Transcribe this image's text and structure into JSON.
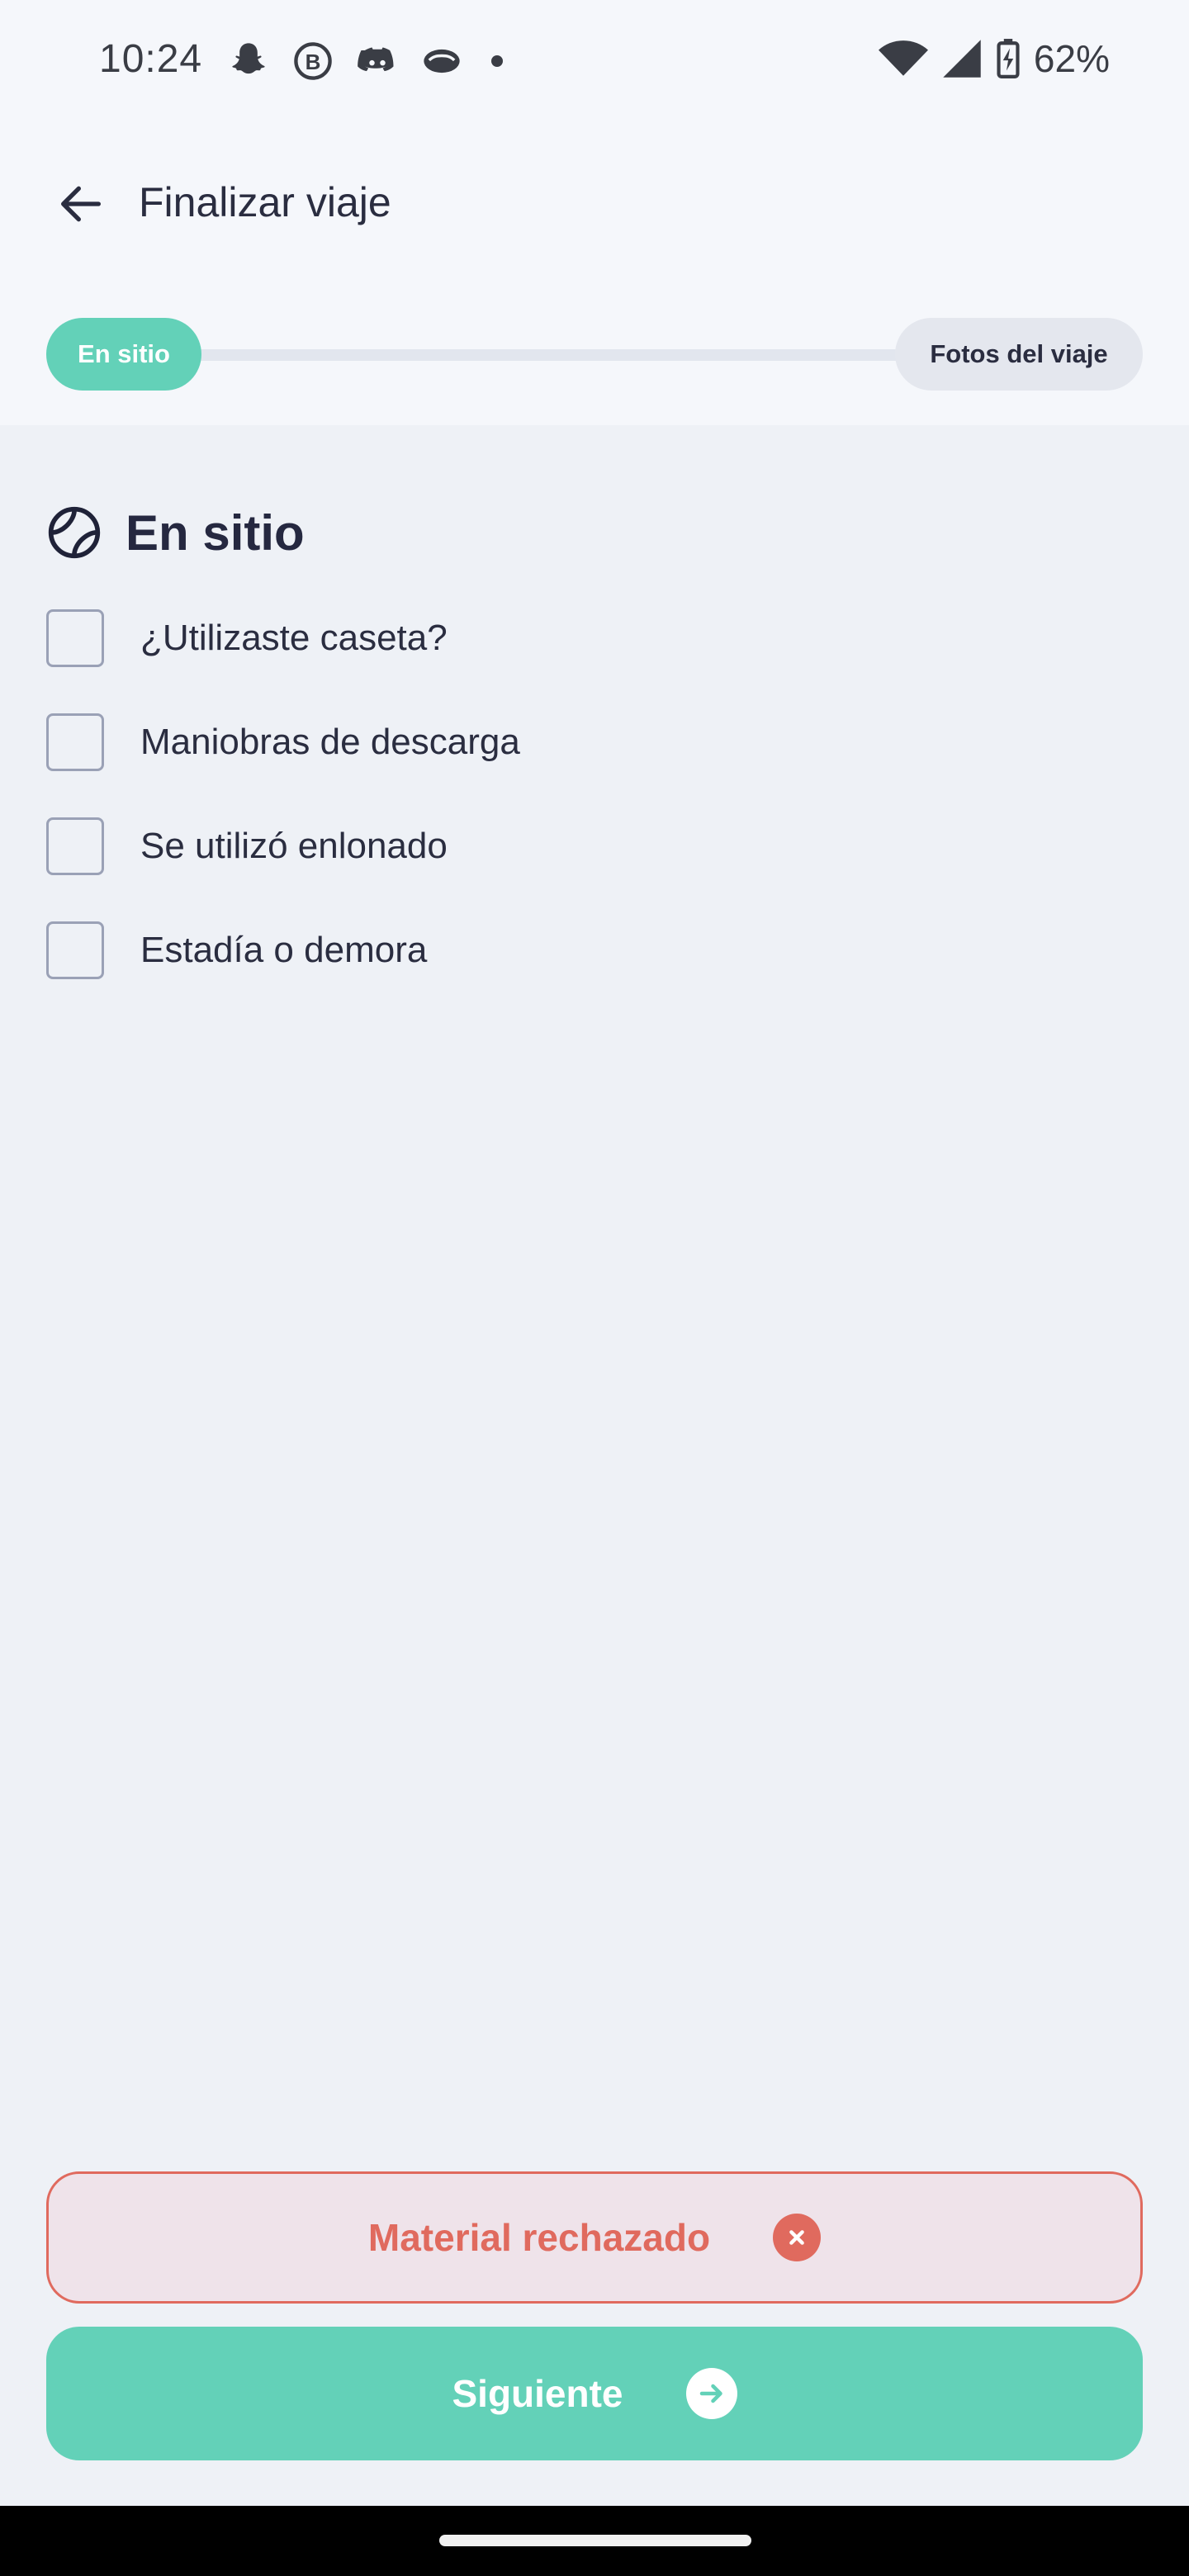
{
  "status_bar": {
    "time": "10:24",
    "battery": "62%",
    "notification_icons": [
      "snapchat-icon",
      "whatsapp-business-icon",
      "discord-icon",
      "messages-icon"
    ]
  },
  "header": {
    "title": "Finalizar viaje",
    "back_icon": "arrow-left-icon"
  },
  "stepper": {
    "steps": [
      {
        "label": "En sitio",
        "active": true
      },
      {
        "label": "Fotos del viaje",
        "active": false
      }
    ]
  },
  "section": {
    "title": "En sitio",
    "icon": "tennis-ball-icon",
    "items": [
      {
        "label": "¿Utilizaste caseta?",
        "checked": false
      },
      {
        "label": "Maniobras de descarga",
        "checked": false
      },
      {
        "label": "Se utilizó enlonado",
        "checked": false
      },
      {
        "label": "Estadía o demora",
        "checked": false
      }
    ]
  },
  "actions": {
    "reject_label": "Material rechazado",
    "next_label": "Siguiente"
  },
  "colors": {
    "accent": "#63d1b8",
    "danger": "#e06a5e",
    "danger_bg": "#efe3ea",
    "background": "#eef1f6",
    "header_bg": "#f5f7fb"
  }
}
